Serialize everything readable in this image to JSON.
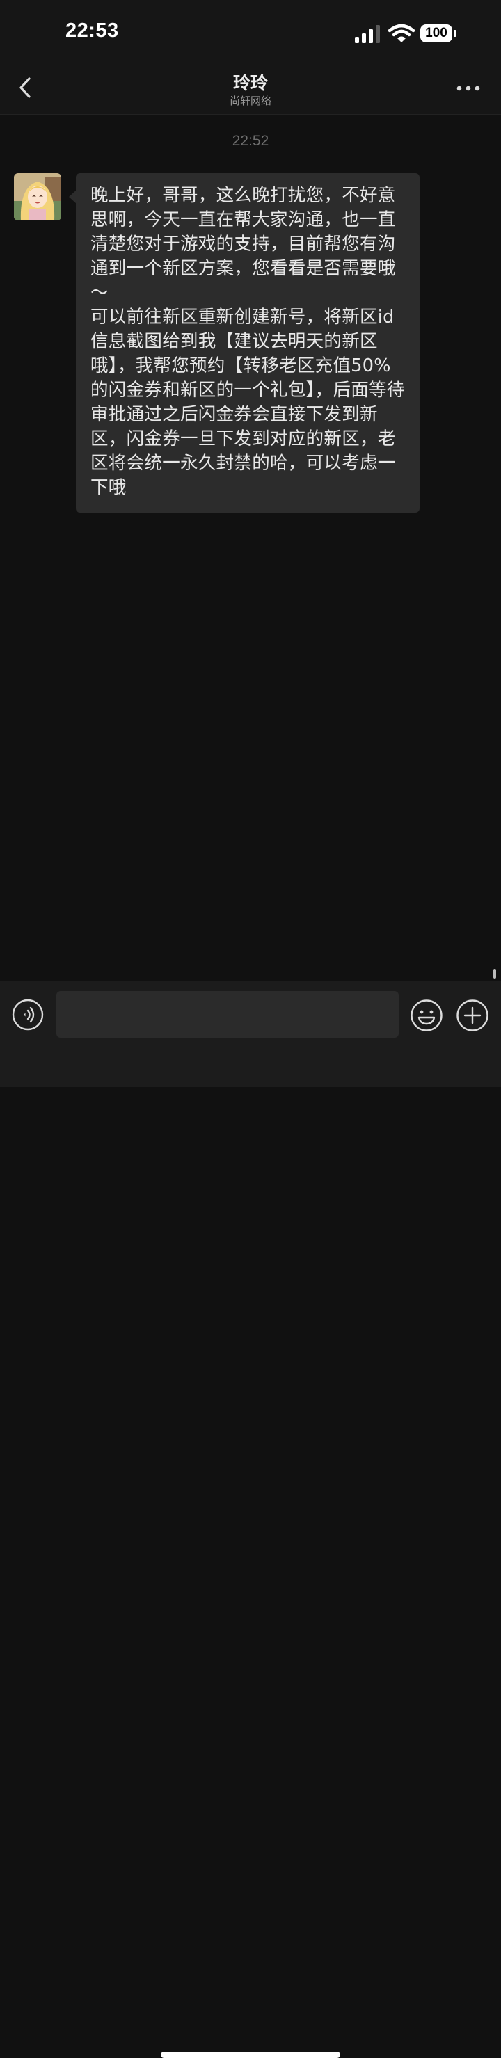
{
  "status_bar": {
    "time": "22:53",
    "battery": "100"
  },
  "header": {
    "title": "玲玲",
    "subtitle": "尚轩网络"
  },
  "chat": {
    "timestamp": "22:52",
    "messages": [
      {
        "sender": "incoming",
        "text": "晚上好，哥哥，这么晚打扰您，不好意思啊，今天一直在帮大家沟通，也一直清楚您对于游戏的支持，目前帮您有沟通到一个新区方案，您看看是否需要哦～\n可以前往新区重新创建新号，将新区id信息截图给到我【建议去明天的新区哦】，我帮您预约【转移老区充值50%的闪金券和新区的一个礼包】，后面等待审批通过之后闪金券会直接下发到新区，闪金券一旦下发到对应的新区，老区将会统一永久封禁的哈，可以考虑一下哦"
      }
    ]
  },
  "input": {
    "value": "",
    "placeholder": ""
  },
  "icons": {
    "back": "chevron-left-icon",
    "more": "more-dots-icon",
    "voice": "voice-icon",
    "emoji": "emoji-icon",
    "add": "plus-circle-icon",
    "signal": "signal-icon",
    "wifi": "wifi-icon"
  },
  "colors": {
    "background": "#111111",
    "bar_background": "#161616",
    "bubble": "#2c2c2c",
    "text": "#e8e8e8",
    "timestamp": "#6e6e6e"
  }
}
